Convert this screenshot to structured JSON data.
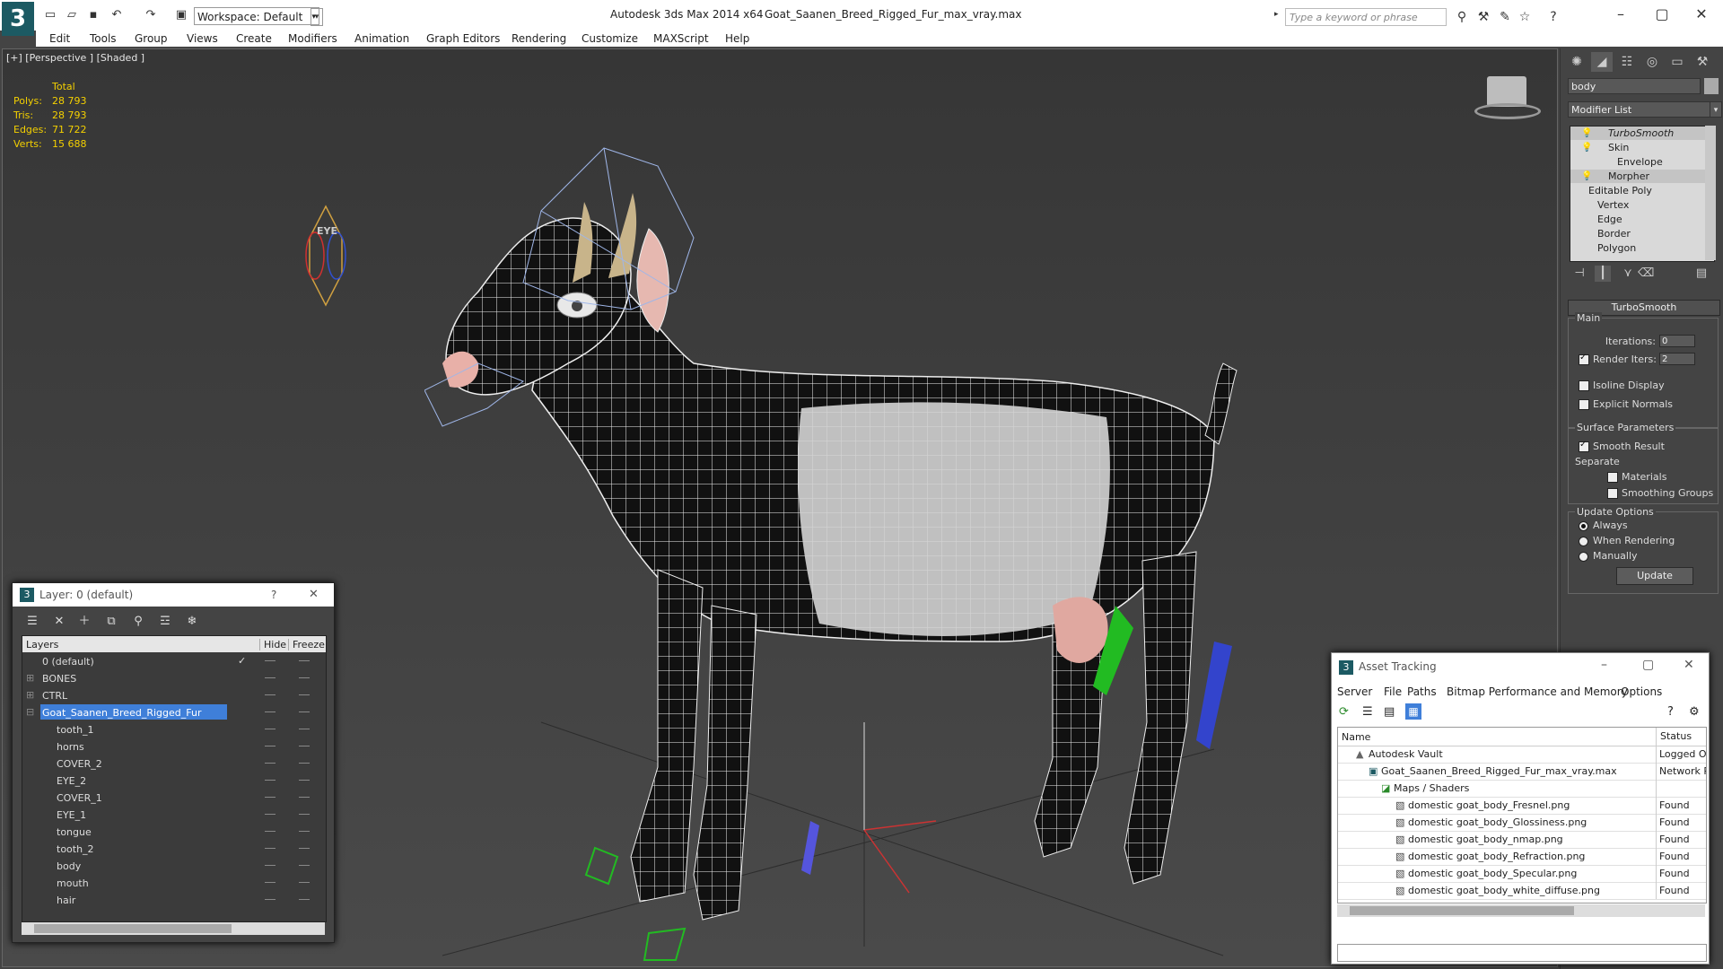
{
  "app": {
    "title": "Autodesk 3ds Max  2014 x64",
    "file": "Goat_Saanen_Breed_Rigged_Fur_max_vray.max",
    "workspace": "Workspace: Default",
    "search_placeholder": "Type a keyword or phrase"
  },
  "menu": [
    "Edit",
    "Tools",
    "Group",
    "Views",
    "Create",
    "Modifiers",
    "Animation",
    "Graph Editors",
    "Rendering",
    "Customize",
    "MAXScript",
    "Help"
  ],
  "viewport": {
    "label": "[+] [Perspective ] [Shaded ]",
    "stats": {
      "header": "Total",
      "rows": [
        {
          "label": "Polys:",
          "value": "28 793"
        },
        {
          "label": "Tris:",
          "value": "28 793"
        },
        {
          "label": "Edges:",
          "value": "71 722"
        },
        {
          "label": "Verts:",
          "value": "15 688"
        }
      ]
    },
    "eye_label": "EYE"
  },
  "command_panel": {
    "object_name": "body",
    "modifier_list": "Modifier List",
    "stack": [
      "TurboSmooth",
      "Skin",
      "Envelope",
      "Morpher",
      "Editable Poly",
      "Vertex",
      "Edge",
      "Border",
      "Polygon"
    ],
    "rollout": "TurboSmooth",
    "main_label": "Main",
    "iterations_label": "Iterations:",
    "iterations_value": "0",
    "render_iters_label": "Render Iters:",
    "render_iters_value": "2",
    "isoline": "Isoline Display",
    "explicit": "Explicit Normals",
    "surface_params": "Surface Parameters",
    "smooth_result": "Smooth Result",
    "separate": "Separate",
    "materials": "Materials",
    "smoothing_groups": "Smoothing Groups",
    "update_options": "Update Options",
    "always": "Always",
    "when_rendering": "When Rendering",
    "manually": "Manually",
    "update_btn": "Update"
  },
  "layer_dialog": {
    "title": "Layer: 0 (default)",
    "help": "?",
    "close": "✕",
    "col_layers": "Layers",
    "col_hide": "Hide",
    "col_freeze": "Freeze",
    "rows": [
      "0 (default)",
      "BONES",
      "CTRL",
      "Goat_Saanen_Breed_Rigged_Fur",
      "tooth_1",
      "horns",
      "COVER_2",
      "EYE_2",
      "COVER_1",
      "EYE_1",
      "tongue",
      "tooth_2",
      "body",
      "mouth",
      "hair"
    ]
  },
  "asset_dialog": {
    "title": "Asset Tracking",
    "menu": [
      "Server",
      "File",
      "Paths",
      "Bitmap Performance and Memory",
      "Options"
    ],
    "col_name": "Name",
    "col_status": "Status",
    "rows": [
      {
        "name": "Autodesk Vault",
        "status": "Logged Ou"
      },
      {
        "name": "Goat_Saanen_Breed_Rigged_Fur_max_vray.max",
        "status": "Network P"
      },
      {
        "name": "Maps / Shaders",
        "status": ""
      },
      {
        "name": "domestic goat_body_Fresnel.png",
        "status": "Found"
      },
      {
        "name": "domestic goat_body_Glossiness.png",
        "status": "Found"
      },
      {
        "name": "domestic goat_body_nmap.png",
        "status": "Found"
      },
      {
        "name": "domestic goat_body_Refraction.png",
        "status": "Found"
      },
      {
        "name": "domestic goat_body_Specular.png",
        "status": "Found"
      },
      {
        "name": "domestic goat_body_white_diffuse.png",
        "status": "Found"
      }
    ]
  },
  "colors": {
    "accent": "#3f7fd9",
    "stats": "#f4d000"
  }
}
